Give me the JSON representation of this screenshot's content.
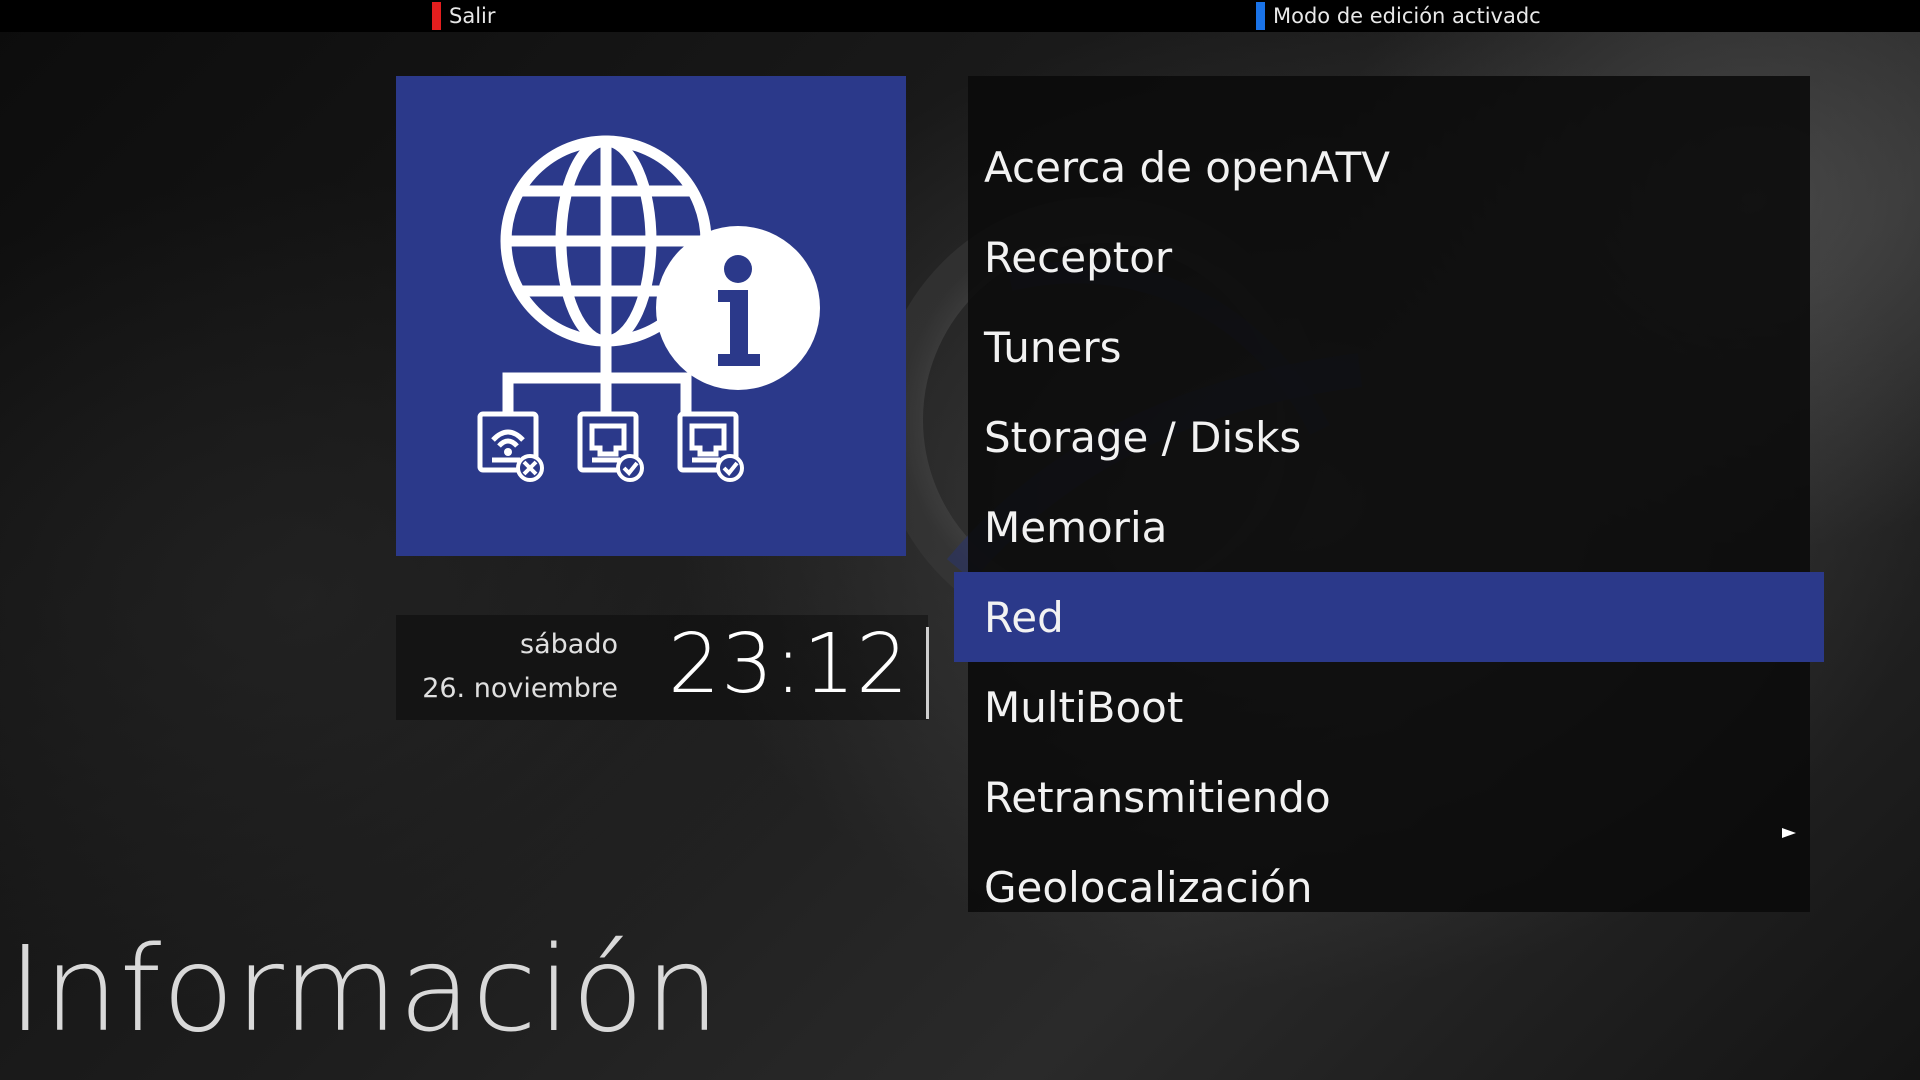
{
  "colors": {
    "accent_blue": "#2b398a",
    "key_red": "#e31e1e",
    "key_blue": "#1a73e8"
  },
  "topbar": {
    "red_key_label": "Salir",
    "blue_key_label": "Modo de edición activadc"
  },
  "icon_tile": {
    "icon": "network-info-icon"
  },
  "clock": {
    "day": "sábado",
    "date": "26. noviembre",
    "time": "23:12"
  },
  "menu": {
    "selected_index": 5,
    "items": [
      {
        "label": "Acerca de openATV"
      },
      {
        "label": "Receptor"
      },
      {
        "label": "Tuners"
      },
      {
        "label": "Storage / Disks"
      },
      {
        "label": "Memoria"
      },
      {
        "label": "Red"
      },
      {
        "label": "MultiBoot"
      },
      {
        "label": "Retransmitiendo"
      },
      {
        "label": "Geolocalización"
      }
    ]
  },
  "screen_title": "Información"
}
